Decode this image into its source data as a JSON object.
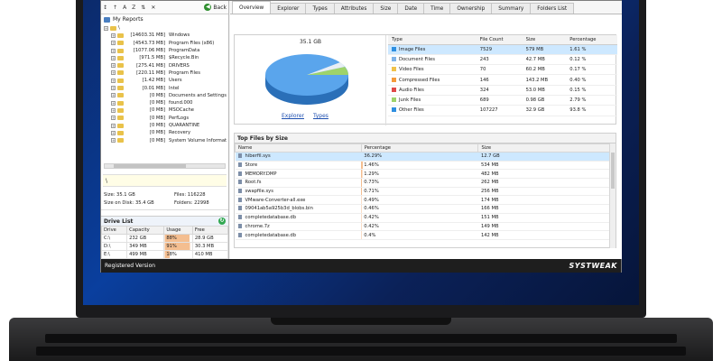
{
  "toolbar": {
    "back_label": "Back"
  },
  "my_reports": "My Reports",
  "tree": [
    {
      "size": "",
      "name": "\\"
    },
    {
      "size": "[14603.31 MB]",
      "name": "Windows"
    },
    {
      "size": "[4543.73 MB]",
      "name": "Program Files (x86)"
    },
    {
      "size": "[1077.06 MB]",
      "name": "ProgramData"
    },
    {
      "size": "[971.5 MB]",
      "name": "$Recycle.Bin"
    },
    {
      "size": "[275.41 MB]",
      "name": "DRIVERS"
    },
    {
      "size": "[220.11 MB]",
      "name": "Program Files"
    },
    {
      "size": "[1.42 MB]",
      "name": "Users"
    },
    {
      "size": "[0.01 MB]",
      "name": "Intel"
    },
    {
      "size": "[0 MB]",
      "name": "Documents and Settings"
    },
    {
      "size": "[0 MB]",
      "name": "found.000"
    },
    {
      "size": "[0 MB]",
      "name": "MSOCache"
    },
    {
      "size": "[0 MB]",
      "name": "PerfLogs"
    },
    {
      "size": "[0 MB]",
      "name": "QUARANTINE"
    },
    {
      "size": "[0 MB]",
      "name": "Recovery"
    },
    {
      "size": "[0 MB]",
      "name": "System Volume Informat"
    }
  ],
  "path": "\\",
  "sizes": {
    "size": "Size: 35.1 GB",
    "files": "Files: 116228",
    "disk": "Size on Disk: 35.4 GB",
    "folders": "Folders: 22998"
  },
  "drive_list": {
    "title": "Drive List",
    "headers": [
      "Drive",
      "Capacity",
      "Usage",
      "Free"
    ],
    "rows": [
      {
        "drive": "C:\\",
        "capacity": "232 GB",
        "usage": "88%",
        "usage_pct": 88,
        "free": "28.9 GB"
      },
      {
        "drive": "D:\\",
        "capacity": "349 MB",
        "usage": "91%",
        "usage_pct": 91,
        "free": "30.3 MB"
      },
      {
        "drive": "E:\\",
        "capacity": "499 MB",
        "usage": "18%",
        "usage_pct": 18,
        "free": "410 MB"
      }
    ]
  },
  "status": "Registered Version",
  "brand": "SYSTWEAK",
  "tabs": [
    "Overview",
    "Explorer",
    "Types",
    "Attributes",
    "Size",
    "Date",
    "Time",
    "Ownership",
    "Summary",
    "Folders List"
  ],
  "overview": {
    "pie_title": "35.1 GB",
    "links": [
      "Explorer",
      "Types"
    ],
    "headers": [
      "Type",
      "File Count",
      "Size",
      "Percentage"
    ],
    "rows": [
      {
        "type": "Image Files",
        "count": "7529",
        "size": "579 MB",
        "pct": "1.61 %",
        "color": "#2e8fe0"
      },
      {
        "type": "Document Files",
        "count": "243",
        "size": "42.7 MB",
        "pct": "0.12 %",
        "color": "#7fb3e8"
      },
      {
        "type": "Video Files",
        "count": "70",
        "size": "60.2 MB",
        "pct": "0.17 %",
        "color": "#f0c24a"
      },
      {
        "type": "Compressed Files",
        "count": "146",
        "size": "143.2 MB",
        "pct": "0.40 %",
        "color": "#f59a3a"
      },
      {
        "type": "Audio Files",
        "count": "324",
        "size": "53.0 MB",
        "pct": "0.15 %",
        "color": "#e04848"
      },
      {
        "type": "Junk Files",
        "count": "689",
        "size": "0.98 GB",
        "pct": "2.79 %",
        "color": "#9ed36a"
      },
      {
        "type": "Other Files",
        "count": "107227",
        "size": "32.9 GB",
        "pct": "93.8 %",
        "color": "#2e8fe0"
      }
    ]
  },
  "top_files": {
    "title": "Top Files by Size",
    "headers": [
      "Name",
      "Percentage",
      "Size"
    ],
    "rows": [
      {
        "name": "hiberfil.sys",
        "pct": "36.29%",
        "pct_num": 36.29,
        "size": "12.7 GB"
      },
      {
        "name": "Store",
        "pct": "1.46%",
        "pct_num": 1.46,
        "size": "534 MB"
      },
      {
        "name": "MEMORY.DMP",
        "pct": "1.29%",
        "pct_num": 1.29,
        "size": "482 MB"
      },
      {
        "name": "Root.fs",
        "pct": "0.73%",
        "pct_num": 0.73,
        "size": "262 MB"
      },
      {
        "name": "swapfile.sys",
        "pct": "0.71%",
        "pct_num": 0.71,
        "size": "256 MB"
      },
      {
        "name": "VMware-Converter-all.exe",
        "pct": "0.49%",
        "pct_num": 0.49,
        "size": "174 MB"
      },
      {
        "name": "09041ab5a925b3d_blobs.bin",
        "pct": "0.46%",
        "pct_num": 0.46,
        "size": "166 MB"
      },
      {
        "name": "completedatabase.db",
        "pct": "0.42%",
        "pct_num": 0.42,
        "size": "151 MB"
      },
      {
        "name": "chrome.7z",
        "pct": "0.42%",
        "pct_num": 0.42,
        "size": "149 MB"
      },
      {
        "name": "completedatabase.db",
        "pct": "0.4%",
        "pct_num": 0.4,
        "size": "142 MB"
      }
    ]
  }
}
